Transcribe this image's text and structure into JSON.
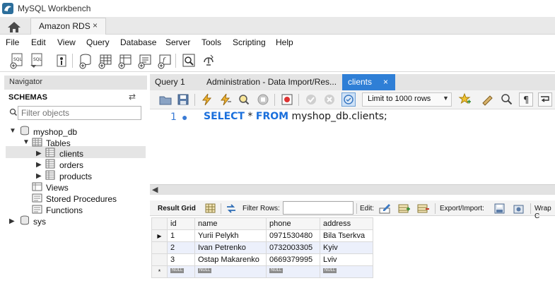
{
  "window": {
    "title": "MySQL Workbench"
  },
  "connection_tab": {
    "label": "Amazon RDS",
    "close": "×"
  },
  "menu": [
    "File",
    "Edit",
    "View",
    "Query",
    "Database",
    "Server",
    "Tools",
    "Scripting",
    "Help"
  ],
  "navigator": {
    "header": "Navigator",
    "schemas_label": "SCHEMAS",
    "filter_placeholder": "Filter objects",
    "tree": {
      "db": "myshop_db",
      "tables_label": "Tables",
      "tables": [
        "clients",
        "orders",
        "products"
      ],
      "views": "Views",
      "procedures": "Stored Procedures",
      "functions": "Functions",
      "sys": "sys"
    }
  },
  "editor_tabs": [
    {
      "label": "Query 1"
    },
    {
      "label": "Administration - Data Import/Res..."
    },
    {
      "label": "clients",
      "close": "×",
      "active": true
    }
  ],
  "editor_toolbar": {
    "limit_label": "Limit to 1000 rows"
  },
  "sql": {
    "line_number": "1",
    "dot": "●",
    "select_kw": "SELECT",
    "star": " * ",
    "from_kw": "FROM",
    "rest": " myshop_db.clients;"
  },
  "result_toolbar": {
    "result_grid_label": "Result Grid",
    "filter_rows_label": "Filter Rows:",
    "edit_label": "Edit:",
    "export_label": "Export/Import:",
    "wrap_label": "Wrap C"
  },
  "grid": {
    "columns": [
      "id",
      "name",
      "phone",
      "address"
    ],
    "rows": [
      [
        "1",
        "Yurii Pelykh",
        "0971530480",
        "Bila Tserkva"
      ],
      [
        "2",
        "Ivan Petrenko",
        "0732003305",
        "Kyiv"
      ],
      [
        "3",
        "Ostap Makarenko",
        "0669379995",
        "Lviv"
      ]
    ],
    "new_row_marker": "*",
    "null_label": "NULL"
  },
  "colors": {
    "active_tab": "#2f7fd6",
    "keyword": "#1a6fdc",
    "row_alt": "#ecf0fb"
  }
}
